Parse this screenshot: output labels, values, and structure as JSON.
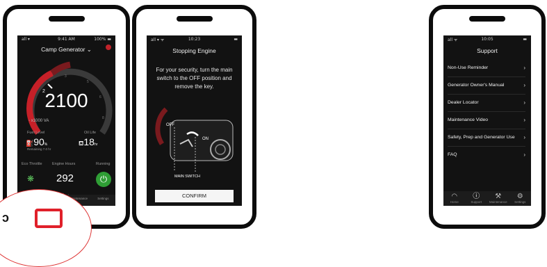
{
  "phone1": {
    "status": {
      "left": "all ▾",
      "center": "9:41 AM",
      "right": "100% ▬"
    },
    "generator_name": "Camp Generator",
    "gauge": {
      "value": "2100",
      "unit": "x1000 VA",
      "ticks": [
        "0",
        "1",
        "2",
        "3",
        "4",
        "5",
        "6",
        "7",
        "8"
      ],
      "redline_tick": "2"
    },
    "fuel": {
      "label": "Fuel Level",
      "value": "90",
      "unit": "%",
      "sub": "Remaining 7.0 hr"
    },
    "oil": {
      "label": "Oil Life",
      "value": "18",
      "unit": "hr"
    },
    "eco": {
      "label": "Eco Throttle"
    },
    "hours": {
      "label": "Engine Hours",
      "value": "292"
    },
    "running": {
      "label": "Running"
    },
    "tabs": [
      "Home",
      "Support",
      "Maintenance",
      "Settings"
    ]
  },
  "phone2": {
    "status": {
      "left": "all ▾ ᯤ",
      "center": "10:23",
      "right": "▬"
    },
    "title": "Stopping Engine",
    "message": "For your security, turn the main switch to the OFF position and remove the key.",
    "labels": {
      "off": "OFF",
      "on": "ON",
      "switch": "MAIN SWITCH"
    },
    "confirm": "CONFIRM"
  },
  "phone3": {
    "status": {
      "left": "all ᯤ",
      "center": "10:05",
      "right": "▬"
    },
    "title": "Support",
    "items": [
      "Non-Use Reminder",
      "Generator Owner's Manual",
      "Dealer Locator",
      "Maintenance Video",
      "Safety, Prep and Generator Use",
      "FAQ"
    ],
    "tabs": [
      "Home",
      "Support",
      "Maintenance",
      "Settings"
    ],
    "active_tab": "Support"
  },
  "fragment": {
    "text": "ɔ"
  }
}
